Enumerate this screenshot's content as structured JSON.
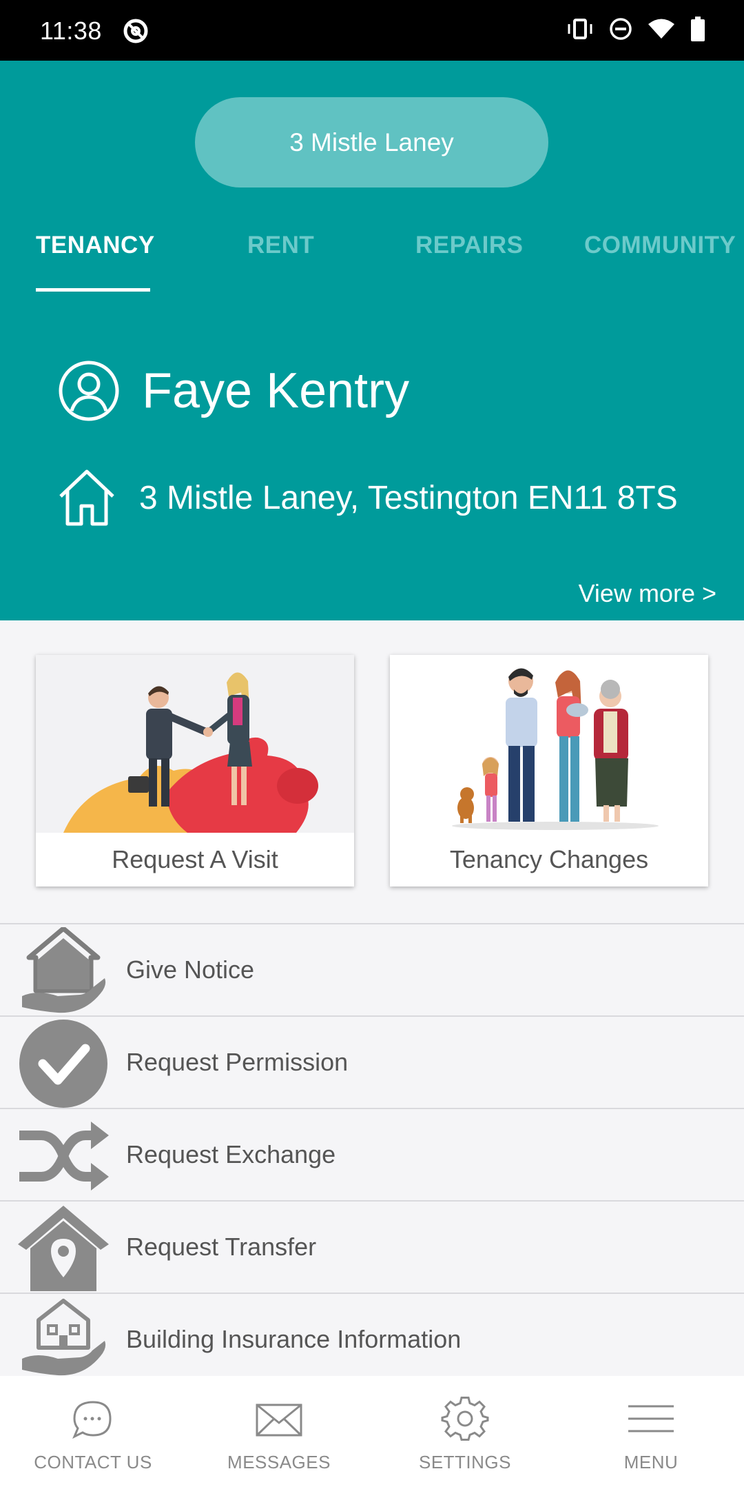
{
  "status_bar": {
    "time": "11:38"
  },
  "header": {
    "property_pill": "3 Mistle Laney",
    "tabs": [
      {
        "label": "TENANCY",
        "active": true
      },
      {
        "label": "RENT",
        "active": false
      },
      {
        "label": "REPAIRS",
        "active": false
      },
      {
        "label": "COMMUNITY",
        "active": false
      }
    ],
    "tenant_name": "Faye Kentry",
    "address": "3 Mistle Laney, Testington EN11 8TS",
    "view_more": "View more >"
  },
  "cards": [
    {
      "label": "Request A Visit",
      "icon": "handshake-puzzle-illustration"
    },
    {
      "label": "Tenancy Changes",
      "icon": "family-illustration"
    }
  ],
  "list": [
    {
      "label": "Give Notice",
      "icon": "house-in-hand-icon"
    },
    {
      "label": "Request Permission",
      "icon": "check-circle-icon"
    },
    {
      "label": "Request Exchange",
      "icon": "shuffle-icon"
    },
    {
      "label": "Request Transfer",
      "icon": "house-location-icon"
    },
    {
      "label": "Building Insurance Information",
      "icon": "insured-house-icon"
    }
  ],
  "bottom_nav": [
    {
      "label": "CONTACT US",
      "icon": "chat-bubble-icon"
    },
    {
      "label": "MESSAGES",
      "icon": "envelope-icon"
    },
    {
      "label": "SETTINGS",
      "icon": "gear-icon"
    },
    {
      "label": "MENU",
      "icon": "hamburger-menu-icon"
    }
  ],
  "colors": {
    "teal": "#009b9b",
    "pill": "#60c2c2",
    "inactive_tab": "#6ccaca",
    "list_text": "#555555",
    "nav_text": "#8a8a8a"
  }
}
